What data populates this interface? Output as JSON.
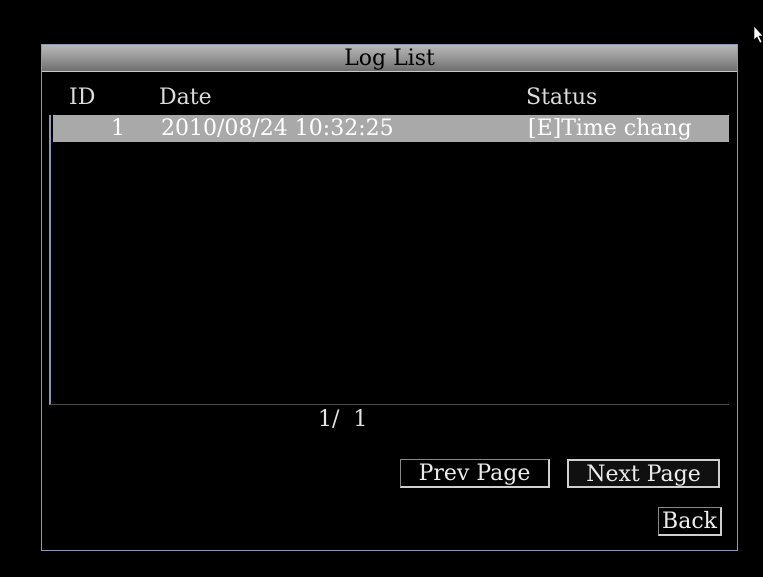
{
  "dialog": {
    "title": "Log List",
    "columns": {
      "id": "ID",
      "date": "Date",
      "status": "Status"
    },
    "rows": [
      {
        "id": "1",
        "date": "2010/08/24 10:32:25",
        "status": "[E]Time chang"
      }
    ],
    "page_indicator": "1/  1",
    "buttons": {
      "prev": "Prev Page",
      "next": "Next Page",
      "back": "Back"
    }
  },
  "icons": {
    "cursor": "mouse-pointer-icon"
  },
  "colors": {
    "background": "#000000",
    "border": "#8a9ab4",
    "selected_row": "#a9a9a9",
    "title_bar": "#9a9a9a"
  }
}
